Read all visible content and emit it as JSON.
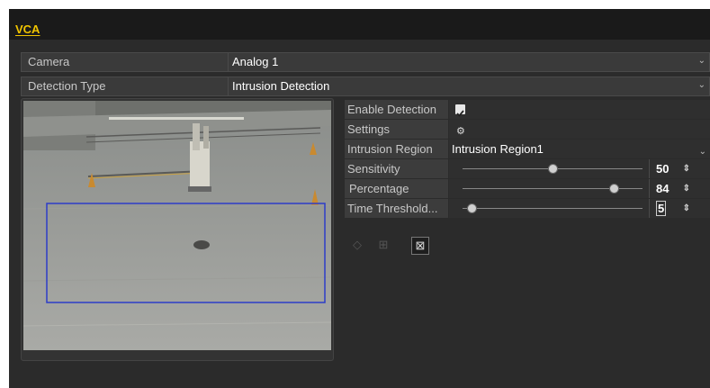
{
  "tab": {
    "label": "VCA"
  },
  "camera": {
    "label": "Camera",
    "value": "Analog 1"
  },
  "detection_type": {
    "label": "Detection Type",
    "value": "Intrusion Detection"
  },
  "settings_panel": {
    "enable_detection": {
      "label": "Enable Detection",
      "checked": true
    },
    "settings": {
      "label": "Settings"
    },
    "intrusion_region": {
      "label": "Intrusion Region",
      "value": "Intrusion Region1"
    },
    "sensitivity": {
      "label": "Sensitivity",
      "value": "50",
      "level": 0.5
    },
    "percentage": {
      "label": "Percentage",
      "value": "84",
      "level": 0.84
    },
    "time_threshold": {
      "label": "Time Threshold...",
      "value": "5",
      "level": 0.05
    }
  },
  "colors": {
    "accent": "#f0c400",
    "region_outline": "#2d3cc8",
    "background": "#2b2b2b"
  },
  "icons": [
    "checkmark-icon",
    "gear-icon",
    "chevron-down-icon",
    "spin-updown-icon",
    "draw-region-icon",
    "clear-region-icon",
    "clear-all-icon"
  ]
}
